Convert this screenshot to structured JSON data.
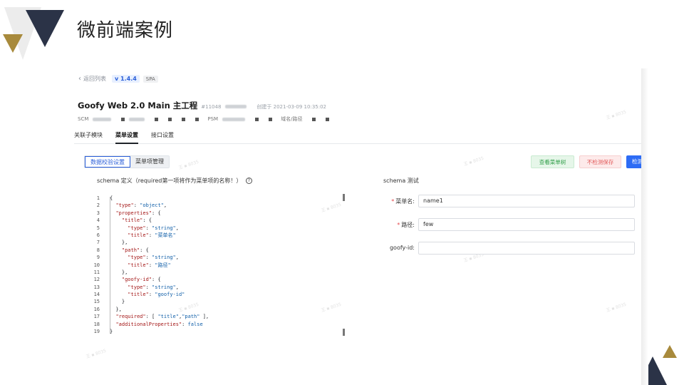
{
  "slide": {
    "title": "微前端案例"
  },
  "app": {
    "back_label": "返回列表",
    "version": "v 1.4.4",
    "type_badge": "SPA",
    "project_name": "Goofy Web 2.0 Main 主工程",
    "project_id": "#11048",
    "created_label": "创建于 2021-03-09 10:35:02",
    "meta": {
      "scm": "SCM",
      "psm": "PSM",
      "domain_path": "域名/路径"
    },
    "tabs": [
      "关联子模块",
      "菜单设置",
      "接口设置"
    ],
    "active_tab": "菜单设置",
    "segments": [
      "数据校验设置",
      "菜单项管理"
    ],
    "buttons": {
      "view_tree": "查看菜单树",
      "save_no_check": "不检测保存",
      "check": "检测"
    },
    "schema_def_title": "schema 定义（required第一项将作为菜单项的名称！）",
    "schema_test_title": "schema 测试",
    "code_lines": [
      {
        "n": "1",
        "t": "{"
      },
      {
        "n": "2",
        "t": "  \"type\": \"object\","
      },
      {
        "n": "3",
        "t": "  \"properties\": {"
      },
      {
        "n": "4",
        "t": "    \"title\": {"
      },
      {
        "n": "5",
        "t": "      \"type\": \"string\","
      },
      {
        "n": "6",
        "t": "      \"title\": \"菜单名\""
      },
      {
        "n": "7",
        "t": "    },"
      },
      {
        "n": "8",
        "t": "    \"path\": {"
      },
      {
        "n": "9",
        "t": "      \"type\": \"string\","
      },
      {
        "n": "10",
        "t": "      \"title\": \"路径\""
      },
      {
        "n": "11",
        "t": "    },"
      },
      {
        "n": "12",
        "t": "    \"goofy-id\": {"
      },
      {
        "n": "13",
        "t": "      \"type\": \"string\","
      },
      {
        "n": "14",
        "t": "      \"title\": \"goofy-id\""
      },
      {
        "n": "15",
        "t": "    }"
      },
      {
        "n": "16",
        "t": "  },"
      },
      {
        "n": "17",
        "t": "  \"required\": [ \"title\",\"path\" ],"
      },
      {
        "n": "18",
        "t": "  \"additionalProperties\": false"
      },
      {
        "n": "19",
        "t": "}"
      }
    ],
    "form": {
      "menu_name_label": "菜单名:",
      "menu_name_value": "name1",
      "path_label": "路径:",
      "path_value": "few",
      "goofy_id_label": "goofy-id:",
      "goofy_id_value": ""
    }
  },
  "colors": {
    "navy": "#2b3347",
    "gold": "#a88a3c",
    "primary": "#2d6cf5"
  }
}
